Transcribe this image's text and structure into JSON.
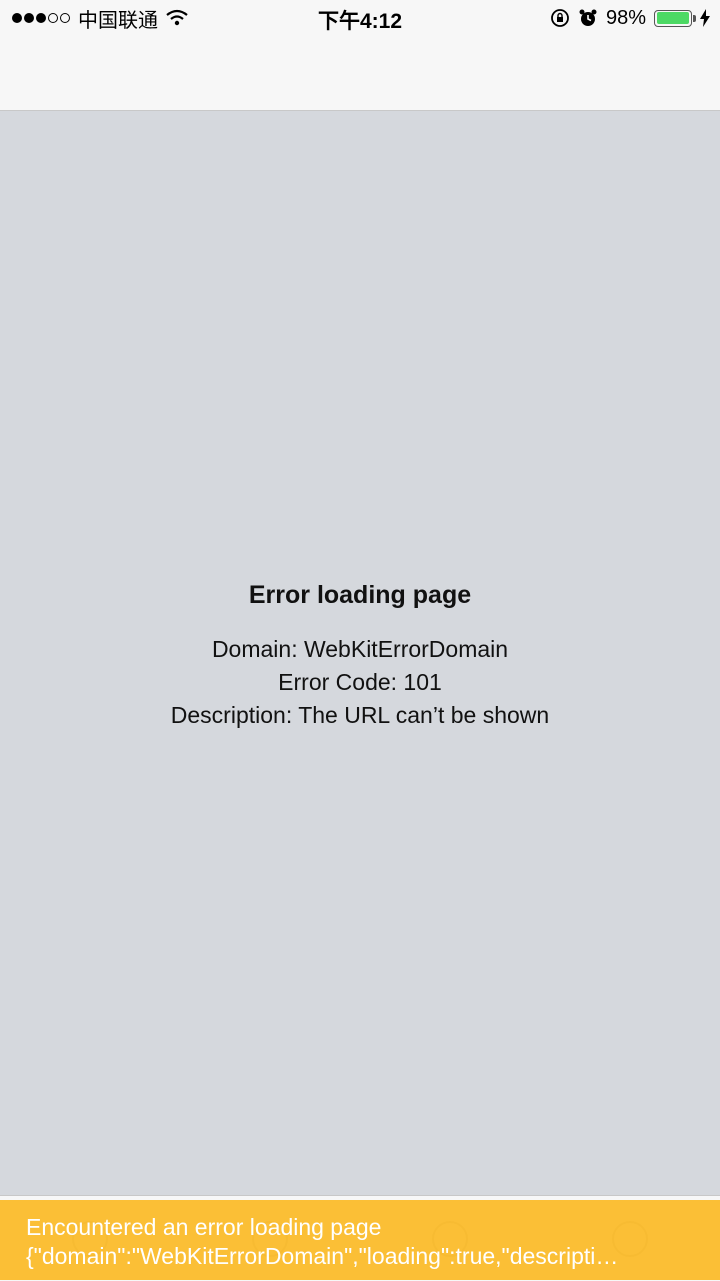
{
  "status_bar": {
    "carrier": "中国联通",
    "time": "下午4:12",
    "battery_percent": "98%",
    "battery_level": 0.98,
    "signal_bars_filled": 3,
    "signal_bars_total": 5
  },
  "error": {
    "title": "Error loading page",
    "domain_line": "Domain: WebKitErrorDomain",
    "code_line": "Error Code: 101",
    "description_line": "Description: The URL can’t be shown"
  },
  "tab_bar": {
    "items": [
      {
        "icon": "clipboard-icon"
      },
      {
        "icon": "home-icon"
      },
      {
        "icon": "discover-icon"
      },
      {
        "icon": "user-icon"
      }
    ]
  },
  "toast": {
    "line1": "Encountered an error loading page",
    "line2": "{\"domain\":\"WebKitErrorDomain\",\"loading\":true,\"descripti…"
  },
  "colors": {
    "toast_background": "#fbbc2e",
    "battery_fill": "#4cd964",
    "page_background": "#d5d8dd"
  }
}
